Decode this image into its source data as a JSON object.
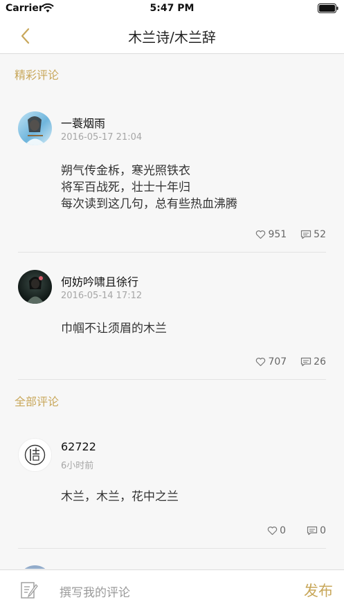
{
  "status_bar": {
    "carrier": "Carrier",
    "time": "5:47 PM"
  },
  "nav": {
    "title": "木兰诗/木兰辞"
  },
  "sections": {
    "featured": "精彩评论",
    "all": "全部评论"
  },
  "featured_comments": [
    {
      "author": "一蓑烟雨",
      "time": "2016-05-17 21:04",
      "lines": [
        "朔气传金柝，寒光照铁衣",
        "将军百战死，壮士十年归",
        "每次读到这几句，总有些热血沸腾"
      ],
      "likes": "951",
      "replies": "52"
    },
    {
      "author": "何妨吟啸且徐行",
      "time": "2016-05-14 17:12",
      "lines": [
        "巾帼不让须眉的木兰"
      ],
      "likes": "707",
      "replies": "26"
    }
  ],
  "all_comments": [
    {
      "author": "62722",
      "time": "6小时前",
      "lines": [
        "木兰，木兰，花中之兰"
      ],
      "likes": "0",
      "replies": "0"
    }
  ],
  "bottom_bar": {
    "placeholder": "撰写我的评论",
    "publish_label": "发布"
  },
  "colors": {
    "accent": "#c8a75a"
  },
  "icons": [
    "wifi-icon",
    "battery-icon",
    "back-icon",
    "heart-icon",
    "comment-bubble-icon",
    "compose-icon"
  ]
}
